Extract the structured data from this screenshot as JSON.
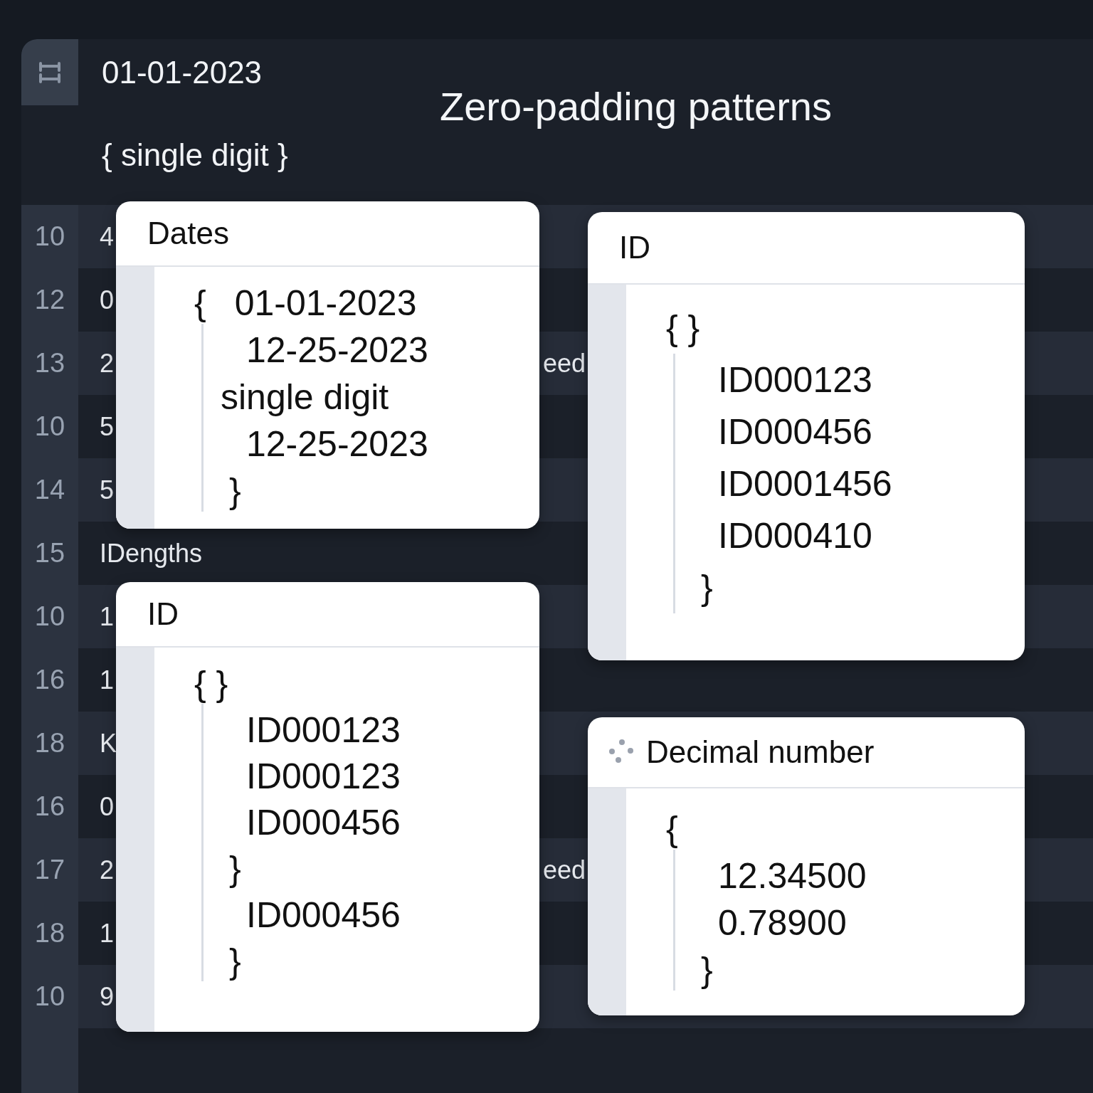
{
  "editor": {
    "header_lines": [
      "01-01-2023",
      "{ single digit }"
    ],
    "title": "Zero-padding patterns",
    "lines": [
      {
        "number": "10",
        "text": "4"
      },
      {
        "number": "12",
        "text": "0"
      },
      {
        "number": "13",
        "text": "2",
        "tail": "eed"
      },
      {
        "number": "10",
        "text": "5"
      },
      {
        "number": "14",
        "text": "5"
      },
      {
        "number": "15",
        "text": "IDengths"
      },
      {
        "number": "10",
        "text": "1"
      },
      {
        "number": "16",
        "text": "1"
      },
      {
        "number": "18",
        "text": "K"
      },
      {
        "number": "16",
        "text": "0"
      },
      {
        "number": "17",
        "text": "2",
        "tail": "eed"
      },
      {
        "number": "18",
        "text": "1"
      },
      {
        "number": "10",
        "text": "9"
      }
    ]
  },
  "cards": [
    {
      "title": "Dates",
      "icon": false,
      "lines": [
        {
          "kind": "open",
          "text": "{",
          "value": "01-01-2023"
        },
        {
          "kind": "value",
          "text": "12-25-2023"
        },
        {
          "kind": "note",
          "text": "single digit"
        },
        {
          "kind": "value",
          "text": "12-25-2023"
        },
        {
          "kind": "close",
          "text": "}"
        }
      ]
    },
    {
      "title": "ID",
      "icon": false,
      "lines": [
        {
          "kind": "open",
          "text": "{ }"
        },
        {
          "kind": "value",
          "text": "ID000123"
        },
        {
          "kind": "value",
          "text": "ID000456"
        },
        {
          "kind": "value",
          "text": "ID0001456"
        },
        {
          "kind": "value",
          "text": "ID000410"
        },
        {
          "kind": "close",
          "text": "}"
        }
      ]
    },
    {
      "title": "ID",
      "icon": false,
      "lines": [
        {
          "kind": "open",
          "text": "{ }"
        },
        {
          "kind": "value",
          "text": "ID000123"
        },
        {
          "kind": "value",
          "text": "ID000123"
        },
        {
          "kind": "value",
          "text": "ID000456"
        },
        {
          "kind": "close",
          "text": "}"
        },
        {
          "kind": "value",
          "text": "ID000456"
        },
        {
          "kind": "close",
          "text": "}"
        }
      ]
    },
    {
      "title": "Decimal number",
      "icon": true,
      "lines": [
        {
          "kind": "open",
          "text": "{"
        },
        {
          "kind": "value",
          "text": "12.34500"
        },
        {
          "kind": "value",
          "text": "0.78900"
        },
        {
          "kind": "close",
          "text": "}"
        }
      ]
    }
  ]
}
